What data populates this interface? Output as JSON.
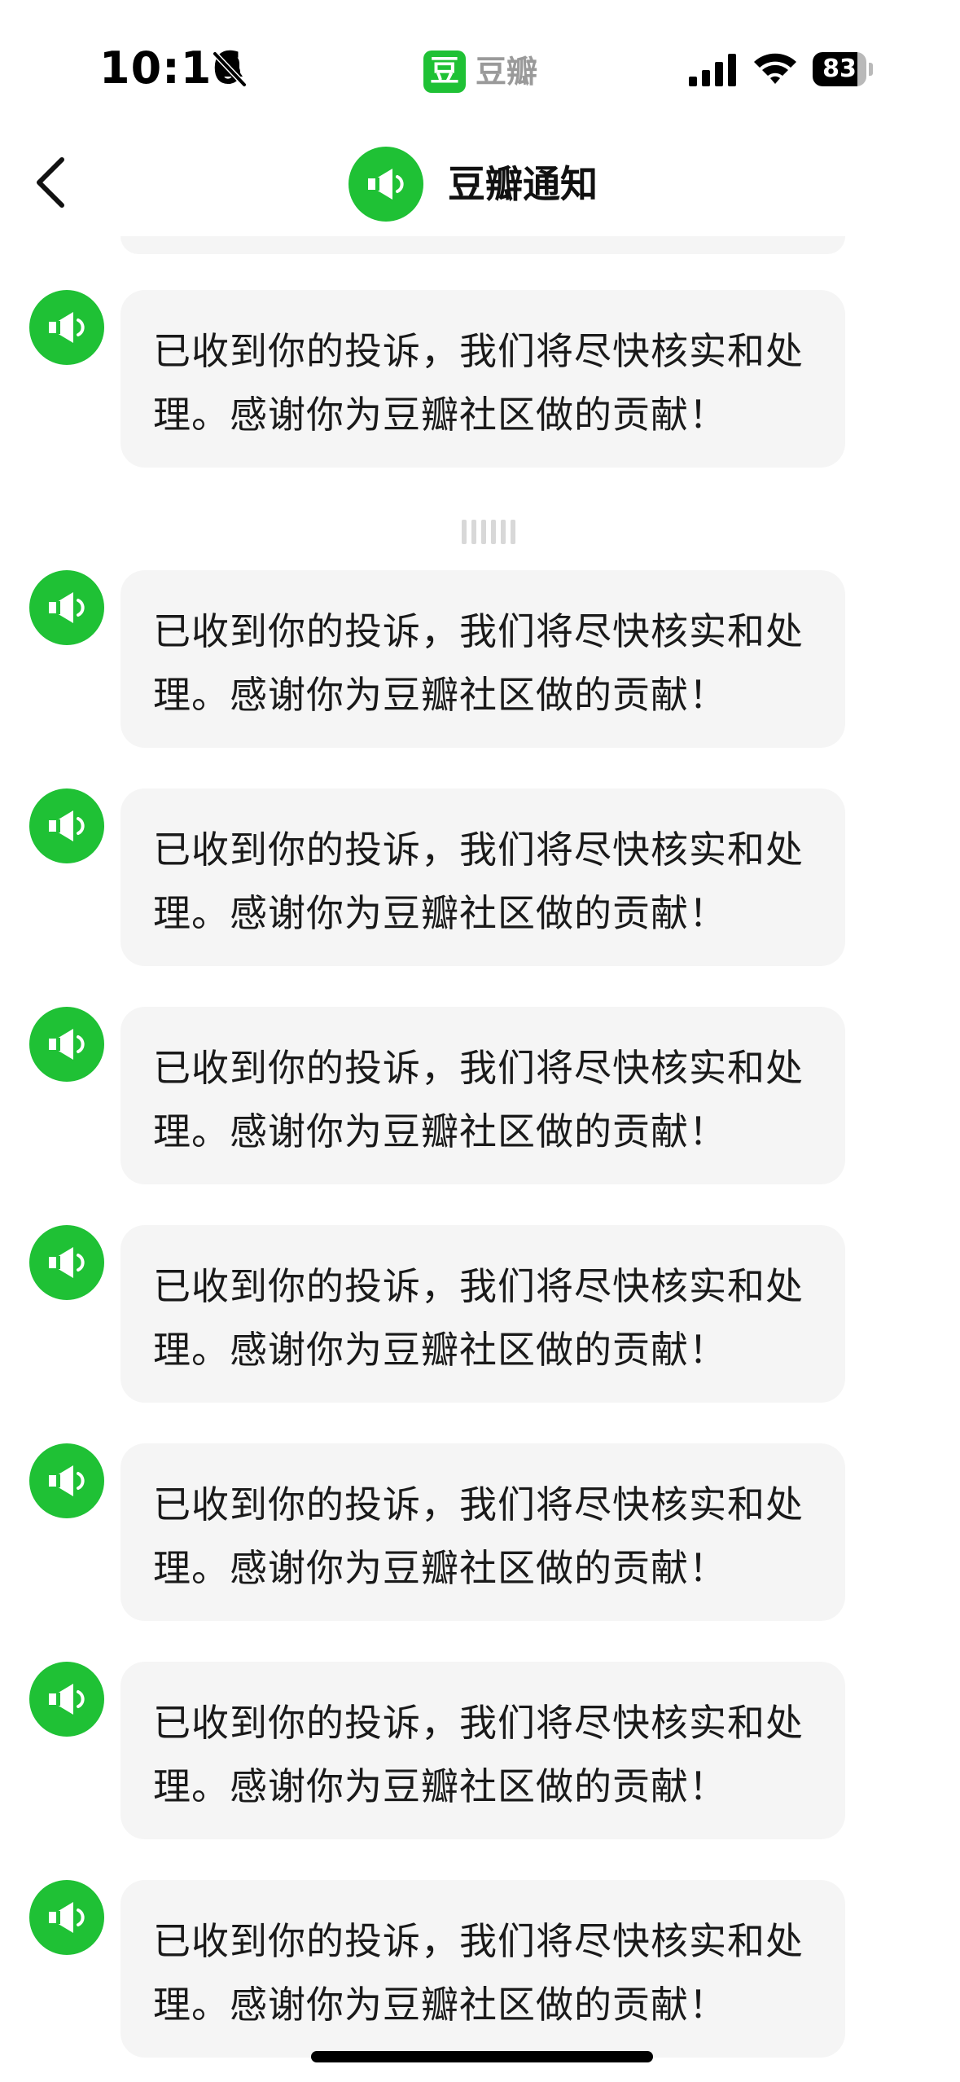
{
  "status_bar": {
    "time": "10:16",
    "app_badge": "豆",
    "app_name": "豆瓣",
    "battery": "83",
    "battery_level": 0.83,
    "icons": [
      "bell-slash-icon",
      "cellular-signal-icon",
      "wifi-icon",
      "battery-icon"
    ]
  },
  "nav": {
    "title": "豆瓣通知",
    "back_icon": "chevron-left-icon",
    "avatar_icon": "megaphone-icon"
  },
  "colors": {
    "brand_green": "#1fc135",
    "bubble_bg": "#f5f5f5",
    "text": "#1a1a1a"
  },
  "messages": [
    {
      "text": "已收到你的投诉，我们将尽快核实和处理。感谢你为豆瓣社区做的贡献！"
    },
    {
      "text": "已收到你的投诉，我们将尽快核实和处理。感谢你为豆瓣社区做的贡献！"
    },
    {
      "text": "已收到你的投诉，我们将尽快核实和处理。感谢你为豆瓣社区做的贡献！"
    },
    {
      "text": "已收到你的投诉，我们将尽快核实和处理。感谢你为豆瓣社区做的贡献！"
    },
    {
      "text": "已收到你的投诉，我们将尽快核实和处理。感谢你为豆瓣社区做的贡献！"
    },
    {
      "text": "已收到你的投诉，我们将尽快核实和处理。感谢你为豆瓣社区做的贡献！"
    },
    {
      "text": "已收到你的投诉，我们将尽快核实和处理。感谢你为豆瓣社区做的贡献！"
    },
    {
      "text": "已收到你的投诉，我们将尽快核实和处理。感谢你为豆瓣社区做的贡献！"
    }
  ]
}
